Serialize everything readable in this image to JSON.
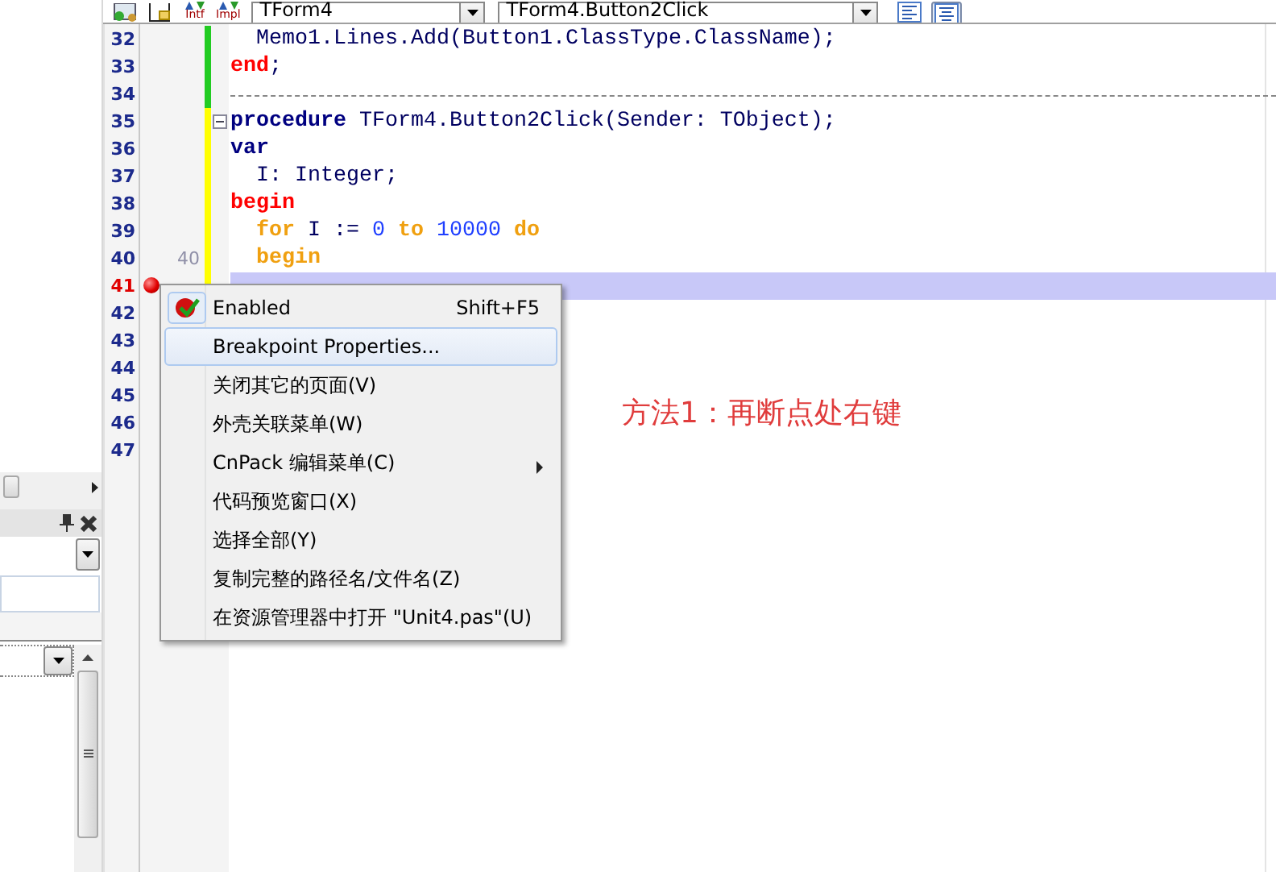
{
  "toolbar": {
    "unit_combo": {
      "value": "TForm4"
    },
    "method_combo": {
      "value": "TForm4.Button2Click"
    },
    "icons": [
      {
        "kind": "form"
      },
      {
        "kind": "unit"
      },
      {
        "kind": "intf",
        "label": "Intf"
      },
      {
        "kind": "impl",
        "label": "Impl"
      }
    ]
  },
  "editor": {
    "lines": [
      {
        "number": "32",
        "color": "#22cc22",
        "tokens": [
          {
            "text": "  Memo1.Lines.Add(Button1.ClassType.ClassName);",
            "kind": "plain"
          }
        ]
      },
      {
        "number": "33",
        "color": "#22cc22",
        "tokens": [
          {
            "text": "end",
            "kind": "block"
          },
          {
            "text": ";",
            "kind": "plain"
          }
        ]
      },
      {
        "number": "34",
        "color": "#22cc22",
        "separator": true
      },
      {
        "number": "35",
        "color": "#ffff00",
        "fold": true,
        "tokens": [
          {
            "text": "procedure",
            "kind": "keyword"
          },
          {
            "text": " TForm4.Button2Click(Sender: TObject);",
            "kind": "plain"
          }
        ]
      },
      {
        "number": "36",
        "color": "#ffff00",
        "tokens": [
          {
            "text": "var",
            "kind": "keyword"
          }
        ]
      },
      {
        "number": "37",
        "color": "#ffff00",
        "tokens": [
          {
            "text": "  I: Integer;",
            "kind": "plain"
          }
        ]
      },
      {
        "number": "38",
        "color": "#ffff00",
        "tokens": [
          {
            "text": "begin",
            "kind": "block"
          }
        ]
      },
      {
        "number": "39",
        "color": "#ffff00",
        "tokens": [
          {
            "text": "  for",
            "kind": "flow"
          },
          {
            "text": " I := ",
            "kind": "plain"
          },
          {
            "text": "0",
            "kind": "number"
          },
          {
            "text": " to ",
            "kind": "flow"
          },
          {
            "text": "10000",
            "kind": "number"
          },
          {
            "text": " do",
            "kind": "flow"
          }
        ]
      },
      {
        "number": "40",
        "color": "#ffff00",
        "marker": "40",
        "tokens": [
          {
            "text": "  begin",
            "kind": "flow"
          }
        ]
      },
      {
        "number": "41",
        "color": "#ffff00",
        "breakpoint": true,
        "highlighted": true
      },
      {
        "number": "42"
      },
      {
        "number": "43"
      },
      {
        "number": "44"
      },
      {
        "number": "45"
      },
      {
        "number": "46"
      },
      {
        "number": "47"
      }
    ]
  },
  "context_menu": {
    "items": [
      {
        "label": "Enabled",
        "shortcut": "Shift+F5",
        "checked": true,
        "selected": false
      },
      {
        "label": "Breakpoint Properties...",
        "selected": true
      },
      {
        "label": "关闭其它的页面(V)",
        "selected": false
      },
      {
        "label": "外壳关联菜单(W)",
        "selected": false
      },
      {
        "label": "CnPack 编辑菜单(C)",
        "selected": false,
        "submenu": true
      },
      {
        "label": "代码预览窗口(X)",
        "selected": false
      },
      {
        "label": "选择全部(Y)",
        "selected": false
      },
      {
        "label": "复制完整的路径名/文件名(Z)",
        "selected": false
      },
      {
        "label": "在资源管理器中打开 \"Unit4.pas\"(U)",
        "selected": false
      }
    ]
  },
  "annotation": "方法1：再断点处右键"
}
